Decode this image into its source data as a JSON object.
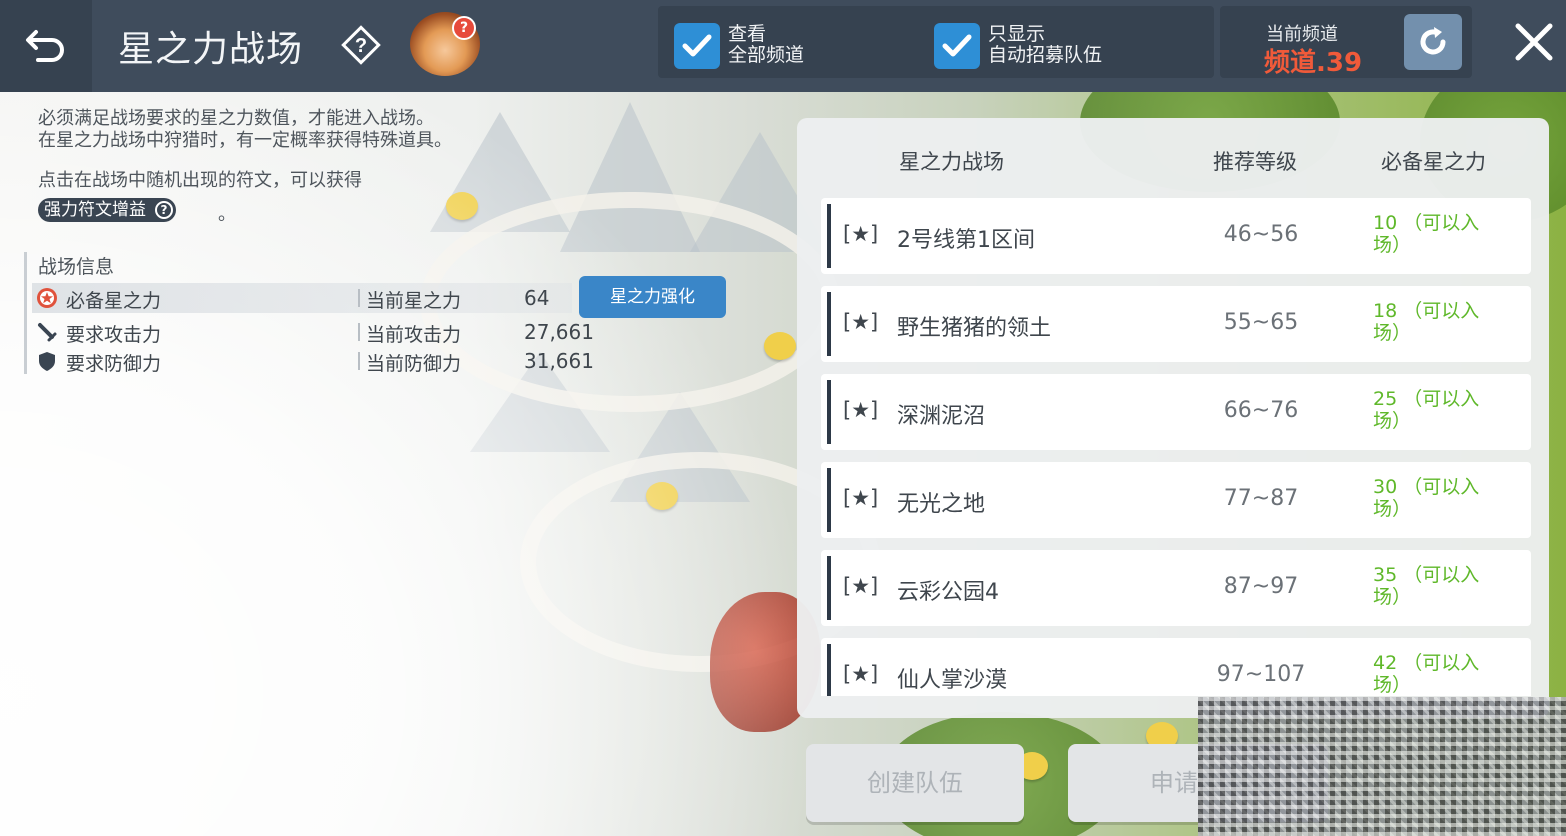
{
  "header": {
    "title": "星之力战场",
    "filters": [
      {
        "line1": "查看",
        "line2": "全部频道",
        "checked": true
      },
      {
        "line1": "只显示",
        "line2": "自动招募队伍",
        "checked": true
      }
    ],
    "channel": {
      "caption": "当前频道",
      "value": "频道.39"
    }
  },
  "info": {
    "desc_line1": "必须满足战场要求的星之力数值，才能进入战场。",
    "desc_line2": "在星之力战场中狩猎时，有一定概率获得特殊道具。",
    "desc_line3": "点击在战场中随机出现的符文，可以获得",
    "buff_label": "强力符文增益",
    "buff_help": "?",
    "buff_suffix": "。",
    "section_title": "战场信息",
    "stats": [
      {
        "label": "必备星之力",
        "current_label": "当前星之力",
        "value": "64",
        "icon": "star-force-icon"
      },
      {
        "label": "要求攻击力",
        "current_label": "当前攻击力",
        "value": "27,661",
        "icon": "sword-icon"
      },
      {
        "label": "要求防御力",
        "current_label": "当前防御力",
        "value": "31,661",
        "icon": "shield-icon"
      }
    ],
    "boost_button": "星之力强化"
  },
  "table": {
    "headers": [
      "星之力战场",
      "推荐等级",
      "必备星之力"
    ],
    "rows": [
      {
        "star": "[★]",
        "name": "2号线第1区间",
        "level": "46~56",
        "required": "10",
        "status": "（可以入场）"
      },
      {
        "star": "[★]",
        "name": "野生猪猪的领土",
        "level": "55~65",
        "required": "18",
        "status": "（可以入场）"
      },
      {
        "star": "[★]",
        "name": "深渊泥沼",
        "level": "66~76",
        "required": "25",
        "status": "（可以入场）"
      },
      {
        "star": "[★]",
        "name": "无光之地",
        "level": "77~87",
        "required": "30",
        "status": "（可以入场）"
      },
      {
        "star": "[★]",
        "name": "云彩公园4",
        "level": "87~97",
        "required": "35",
        "status": "（可以入场）"
      },
      {
        "star": "[★]",
        "name": "仙人掌沙漠",
        "level": "97~107",
        "required": "42",
        "status": "（可以入场）"
      }
    ]
  },
  "bottom": {
    "create_team": "创建队伍",
    "apply_join": "申请加入"
  },
  "colors": {
    "topbar": "#3f4c5c",
    "checkbox": "#2e8fd6",
    "channel_value": "#f05a3a",
    "enterable": "#5fb82a",
    "boost_button": "#3a86c8"
  }
}
